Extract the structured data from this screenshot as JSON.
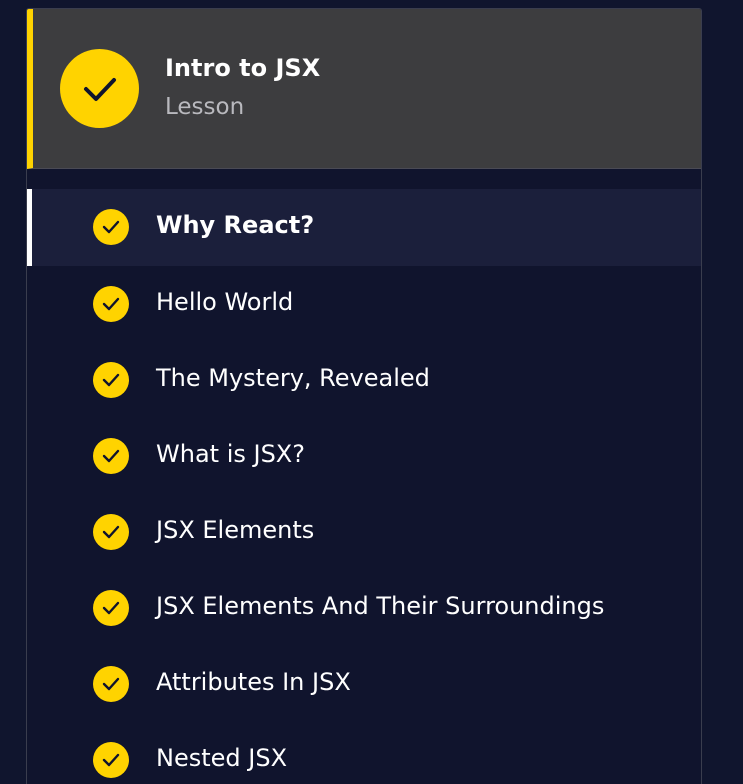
{
  "lesson": {
    "title": "Intro to JSX",
    "type_label": "Lesson",
    "status_icon": "check-icon"
  },
  "colors": {
    "accent": "#ffd300",
    "background": "#10152e",
    "header_bg": "#3d3d3f",
    "active_item_bg": "#1b1f3b"
  },
  "exercises": [
    {
      "label": "Why React?",
      "completed": true,
      "active": true
    },
    {
      "label": "Hello World",
      "completed": true,
      "active": false
    },
    {
      "label": "The Mystery, Revealed",
      "completed": true,
      "active": false
    },
    {
      "label": "What is JSX?",
      "completed": true,
      "active": false
    },
    {
      "label": "JSX Elements",
      "completed": true,
      "active": false
    },
    {
      "label": "JSX Elements And Their Surroundings",
      "completed": true,
      "active": false
    },
    {
      "label": "Attributes In JSX",
      "completed": true,
      "active": false
    },
    {
      "label": "Nested JSX",
      "completed": true,
      "active": false
    }
  ]
}
